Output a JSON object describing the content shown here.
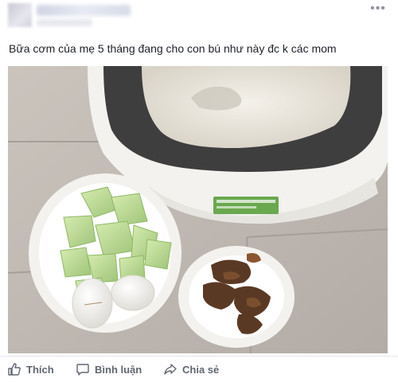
{
  "post": {
    "text": "Bữa cơm của mẹ 5 tháng đang cho con bú như này đc k các mom",
    "photo_icon": "rice-cooker-meal-photo"
  },
  "header": {
    "more_icon": "ellipsis-icon"
  },
  "actions": {
    "like_label": "Thích",
    "comment_label": "Bình luận",
    "share_label": "Chia sẻ"
  },
  "colors": {
    "action_text": "#606770",
    "post_text": "#1d2129",
    "divider": "#e5e6e9"
  }
}
